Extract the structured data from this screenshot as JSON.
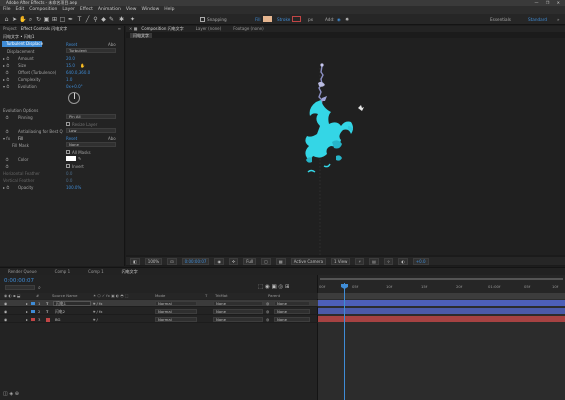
{
  "window": {
    "title": "Adobe After Effects - 未命名项目.aep",
    "controls": "— ❐ ✕"
  },
  "menu": [
    "File",
    "Edit",
    "Composition",
    "Layer",
    "Effect",
    "Animation",
    "View",
    "Window",
    "Help"
  ],
  "toolbar": {
    "snapping_label": "Snapping",
    "fill_label": "Fill",
    "stroke_label": "Stroke",
    "stroke_value": "px",
    "add_label": "Add:",
    "workspace_essentials": "Essentials",
    "workspace_standard": "Standard",
    "accent_color": "#3f8cd6",
    "fill_color": "#e5b58f",
    "stroke_color": "#c04545"
  },
  "project_tabs": [
    "Project",
    "Effect Controls 闪电文字"
  ],
  "effect_controls": {
    "breadcrumb": "闪电文字 • 闪电1",
    "effect_name": "Turbulent Displace",
    "reset_label": "Reset",
    "about_label": "Abo",
    "rows": [
      {
        "label": "Displacement",
        "value": "Turbulent",
        "kind": "dropdown"
      },
      {
        "label": "Amount",
        "value": "20.0",
        "kind": "value"
      },
      {
        "label": "Size",
        "value": "15.0",
        "kind": "value"
      },
      {
        "label": "Offset (Turbulence)",
        "value": "640.0,360.0",
        "kind": "value"
      },
      {
        "label": "Complexity",
        "value": "1.0",
        "kind": "value"
      },
      {
        "label": "Evolution",
        "value": "0x+0.0°",
        "kind": "value"
      },
      {
        "label": "Evolution Options",
        "value": "",
        "kind": "group"
      },
      {
        "label": "Pinning",
        "value": "Pin All",
        "kind": "dropdown"
      },
      {
        "label": "",
        "value": "Resize Layer",
        "kind": "check"
      },
      {
        "label": "Antialiasing for Best Q",
        "value": "Low",
        "kind": "dropdown"
      }
    ],
    "fill_effect": {
      "name": "Fill",
      "reset_label": "Reset",
      "about_label": "Abo",
      "fill_mask_label": "Fill Mask",
      "fill_mask_value": "None",
      "all_masks_label": "All Masks",
      "color_label": "Color",
      "invert_label": "Invert",
      "h_feather_label": "Horizontal Feather",
      "h_feather_value": "0.0",
      "v_feather_label": "Vertical Feather",
      "v_feather_value": "0.0",
      "opacity_label": "Opacity",
      "opacity_value": "100.0%"
    }
  },
  "comp_tabs": [
    "Composition 闪电文字",
    "Layer (none)",
    "Footage (none)"
  ],
  "comp_sub_tab": "闪电文字",
  "comp_footer": {
    "zoom": "100%",
    "timecode": "0:00:00:07",
    "resolution": "Full",
    "camera": "Active Camera",
    "views": "1 View",
    "exposure": "+0.0"
  },
  "timeline_tabs": [
    "Render Queue",
    "Comp 1",
    "Comp 1",
    "闪电文字"
  ],
  "timeline": {
    "timecode": "0:00:00:07",
    "search_placeholder": "",
    "columns": [
      "#",
      "Source Name",
      "Mode",
      "T",
      "TrkMat",
      "Parent"
    ],
    "layers": [
      {
        "index": "1",
        "name": "闪电1",
        "mode": "Normal",
        "trkmat": "None",
        "parent": "None",
        "label_color": "#3f8cd6",
        "selected": true
      },
      {
        "index": "2",
        "name": "闪电2",
        "mode": "Normal",
        "trkmat": "None",
        "parent": "None",
        "label_color": "#3f8cd6",
        "selected": false
      },
      {
        "index": "3",
        "name": "BG",
        "mode": "Normal",
        "trkmat": "None",
        "parent": "None",
        "label_color": "#c04545",
        "selected": false
      }
    ],
    "ruler": [
      "00f",
      "05f",
      "10f",
      "15f",
      "20f",
      "01:00f",
      "05f",
      "10f"
    ]
  }
}
